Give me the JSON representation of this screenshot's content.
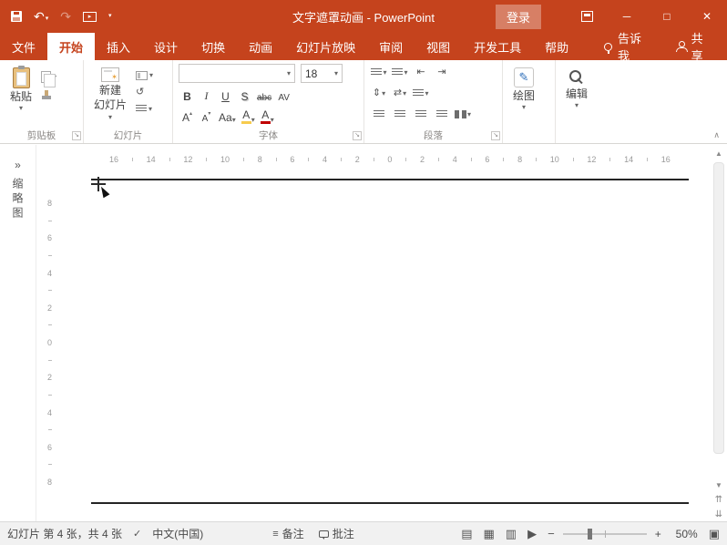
{
  "window": {
    "title": "文字遮罩动画 - PowerPoint",
    "sign_in": "登录"
  },
  "icons": {
    "undo": "↶",
    "redo": "↷",
    "dropdown": "▾",
    "caret_up": "▴",
    "caret_down": "▾",
    "launcher": "↘",
    "minimize": "─",
    "maximize": "□",
    "close": "✕",
    "qat_more": "▾",
    "present": "▸",
    "collapse_ribbon": "∧",
    "pane_expand": "»",
    "scroll_up": "▲",
    "scroll_down": "▼",
    "prev_slide": "⇈",
    "next_slide": "⇊",
    "reset": "↺",
    "pencil": "✎",
    "indent_decrease": "⇤",
    "indent_increase": "⇥",
    "line_spacing": "⇕",
    "text_direction": "⇄",
    "notes": "≡",
    "zoom_out": "−",
    "zoom_in": "+",
    "normal_view": "▤",
    "slide_sorter": "▦",
    "reading_view": "▥",
    "slide_show": "▶",
    "fit_window": "▣",
    "star": "✶",
    "check": "✓"
  },
  "tabs": {
    "items": [
      "文件",
      "开始",
      "插入",
      "设计",
      "切换",
      "动画",
      "幻灯片放映",
      "审阅",
      "视图",
      "开发工具",
      "帮助"
    ],
    "active_index": 1,
    "tell_me": "告诉我",
    "share": "共享"
  },
  "ribbon": {
    "clipboard": {
      "label": "剪贴板",
      "paste": "粘贴"
    },
    "slides": {
      "label": "幻灯片",
      "new_slide_line1": "新建",
      "new_slide_line2": "幻灯片"
    },
    "font": {
      "label": "字体",
      "name_value": "",
      "size_value": "18",
      "bold": "B",
      "italic": "I",
      "underline": "U",
      "shadow": "S",
      "strikethrough": "abc",
      "char_spacing": "AV",
      "grow": "A",
      "shrink": "A",
      "change_case": "Aa",
      "highlight": "A",
      "font_color": "A"
    },
    "paragraph": {
      "label": "段落"
    },
    "drawing": {
      "label": "绘图"
    },
    "editing": {
      "label": "编辑"
    }
  },
  "panes": {
    "thumbnails": "缩略图"
  },
  "rulers": {
    "horizontal": [
      "16",
      "14",
      "12",
      "10",
      "8",
      "6",
      "4",
      "2",
      "0",
      "2",
      "4",
      "6",
      "8",
      "10",
      "12",
      "14",
      "16"
    ],
    "vertical": [
      "8",
      "6",
      "4",
      "2",
      "0",
      "2",
      "4",
      "6",
      "8"
    ]
  },
  "statusbar": {
    "slide_info": "幻灯片 第 4 张，共 4 张",
    "language": "中文(中国)",
    "notes": "备注",
    "comments": "批注",
    "zoom_level": "50%"
  },
  "colors": {
    "titlebar_red": "#C5431D",
    "ribbon_bg": "#FFFFFF",
    "status_bg": "#F1F1F1",
    "slide_line": "#242424",
    "font_color_bar": "#C00000",
    "highlight_bar": "#F7CB4D"
  }
}
